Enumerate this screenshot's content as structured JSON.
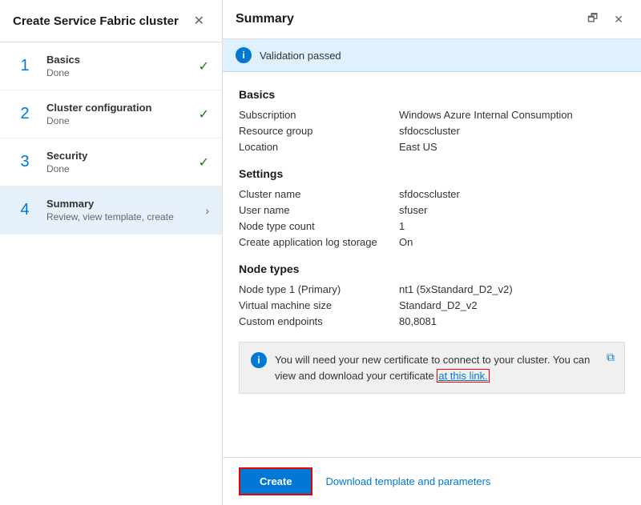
{
  "window": {
    "title": "Create Service Fabric cluster",
    "close_label": "✕"
  },
  "steps": [
    {
      "number": "1",
      "name": "Basics",
      "sub": "Done",
      "check": true,
      "active": false
    },
    {
      "number": "2",
      "name": "Cluster configuration",
      "sub": "Done",
      "check": true,
      "active": false
    },
    {
      "number": "3",
      "name": "Security",
      "sub": "Done",
      "check": true,
      "active": false
    },
    {
      "number": "4",
      "name": "Summary",
      "sub": "Review, view template, create",
      "check": false,
      "active": true
    }
  ],
  "summary_panel": {
    "title": "Summary",
    "validation": {
      "text": "Validation passed"
    },
    "basics": {
      "section_title": "Basics",
      "rows": [
        {
          "label": "Subscription",
          "value": "Windows Azure Internal Consumption"
        },
        {
          "label": "Resource group",
          "value": "sfdocscluster"
        },
        {
          "label": "Location",
          "value": "East US"
        }
      ]
    },
    "settings": {
      "section_title": "Settings",
      "rows": [
        {
          "label": "Cluster name",
          "value": "sfdocscluster"
        },
        {
          "label": "User name",
          "value": "sfuser"
        },
        {
          "label": "Node type count",
          "value": "1"
        },
        {
          "label": "Create application log storage",
          "value": "On"
        }
      ]
    },
    "node_types": {
      "section_title": "Node types",
      "rows": [
        {
          "label": "Node type 1 (Primary)",
          "value": "nt1 (5xStandard_D2_v2)"
        },
        {
          "label": "Virtual machine size",
          "value": "Standard_D2_v2"
        },
        {
          "label": "Custom endpoints",
          "value": "80,8081"
        }
      ]
    },
    "info_box": {
      "text_before": "You will need your new certificate to connect to your cluster. You can view and download your certificate ",
      "link_text": "at this link.",
      "text_after": ""
    },
    "footer": {
      "create_label": "Create",
      "template_label": "Download template and parameters"
    }
  },
  "icons": {
    "minimize": "🗗",
    "close": "✕",
    "external_link": "⧉"
  }
}
